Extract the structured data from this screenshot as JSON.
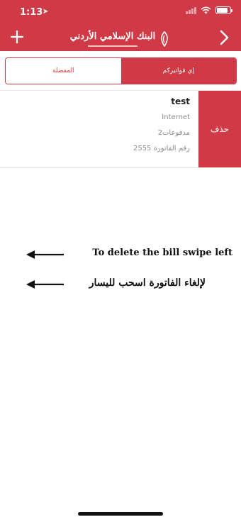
{
  "status_bar": {
    "time": "1:13",
    "battery_level": 0.85
  },
  "header": {
    "brand_name": "البنك الإسلامي الأردني",
    "add_icon": "plus-icon",
    "nav_icon": "chevron-right-icon",
    "logo_icon": "bank-logo-icon",
    "background_color": "#d03a47"
  },
  "segmented_control": {
    "selected": "إي فواتيركم",
    "tabs": [
      {
        "label": "المفضلة"
      },
      {
        "label": "إي فواتيركم"
      }
    ]
  },
  "bill": {
    "title": "test",
    "category": "Internet",
    "payments": "مدفوعات2",
    "bill_number": "رقم الفاتورة 2555",
    "delete_label": "حذف"
  },
  "instructions": {
    "english": "To delete the bill swipe left",
    "arabic": "لإلغاء الفاتورة اسحب لليسار",
    "arrow_icon": "arrow-left-icon"
  }
}
